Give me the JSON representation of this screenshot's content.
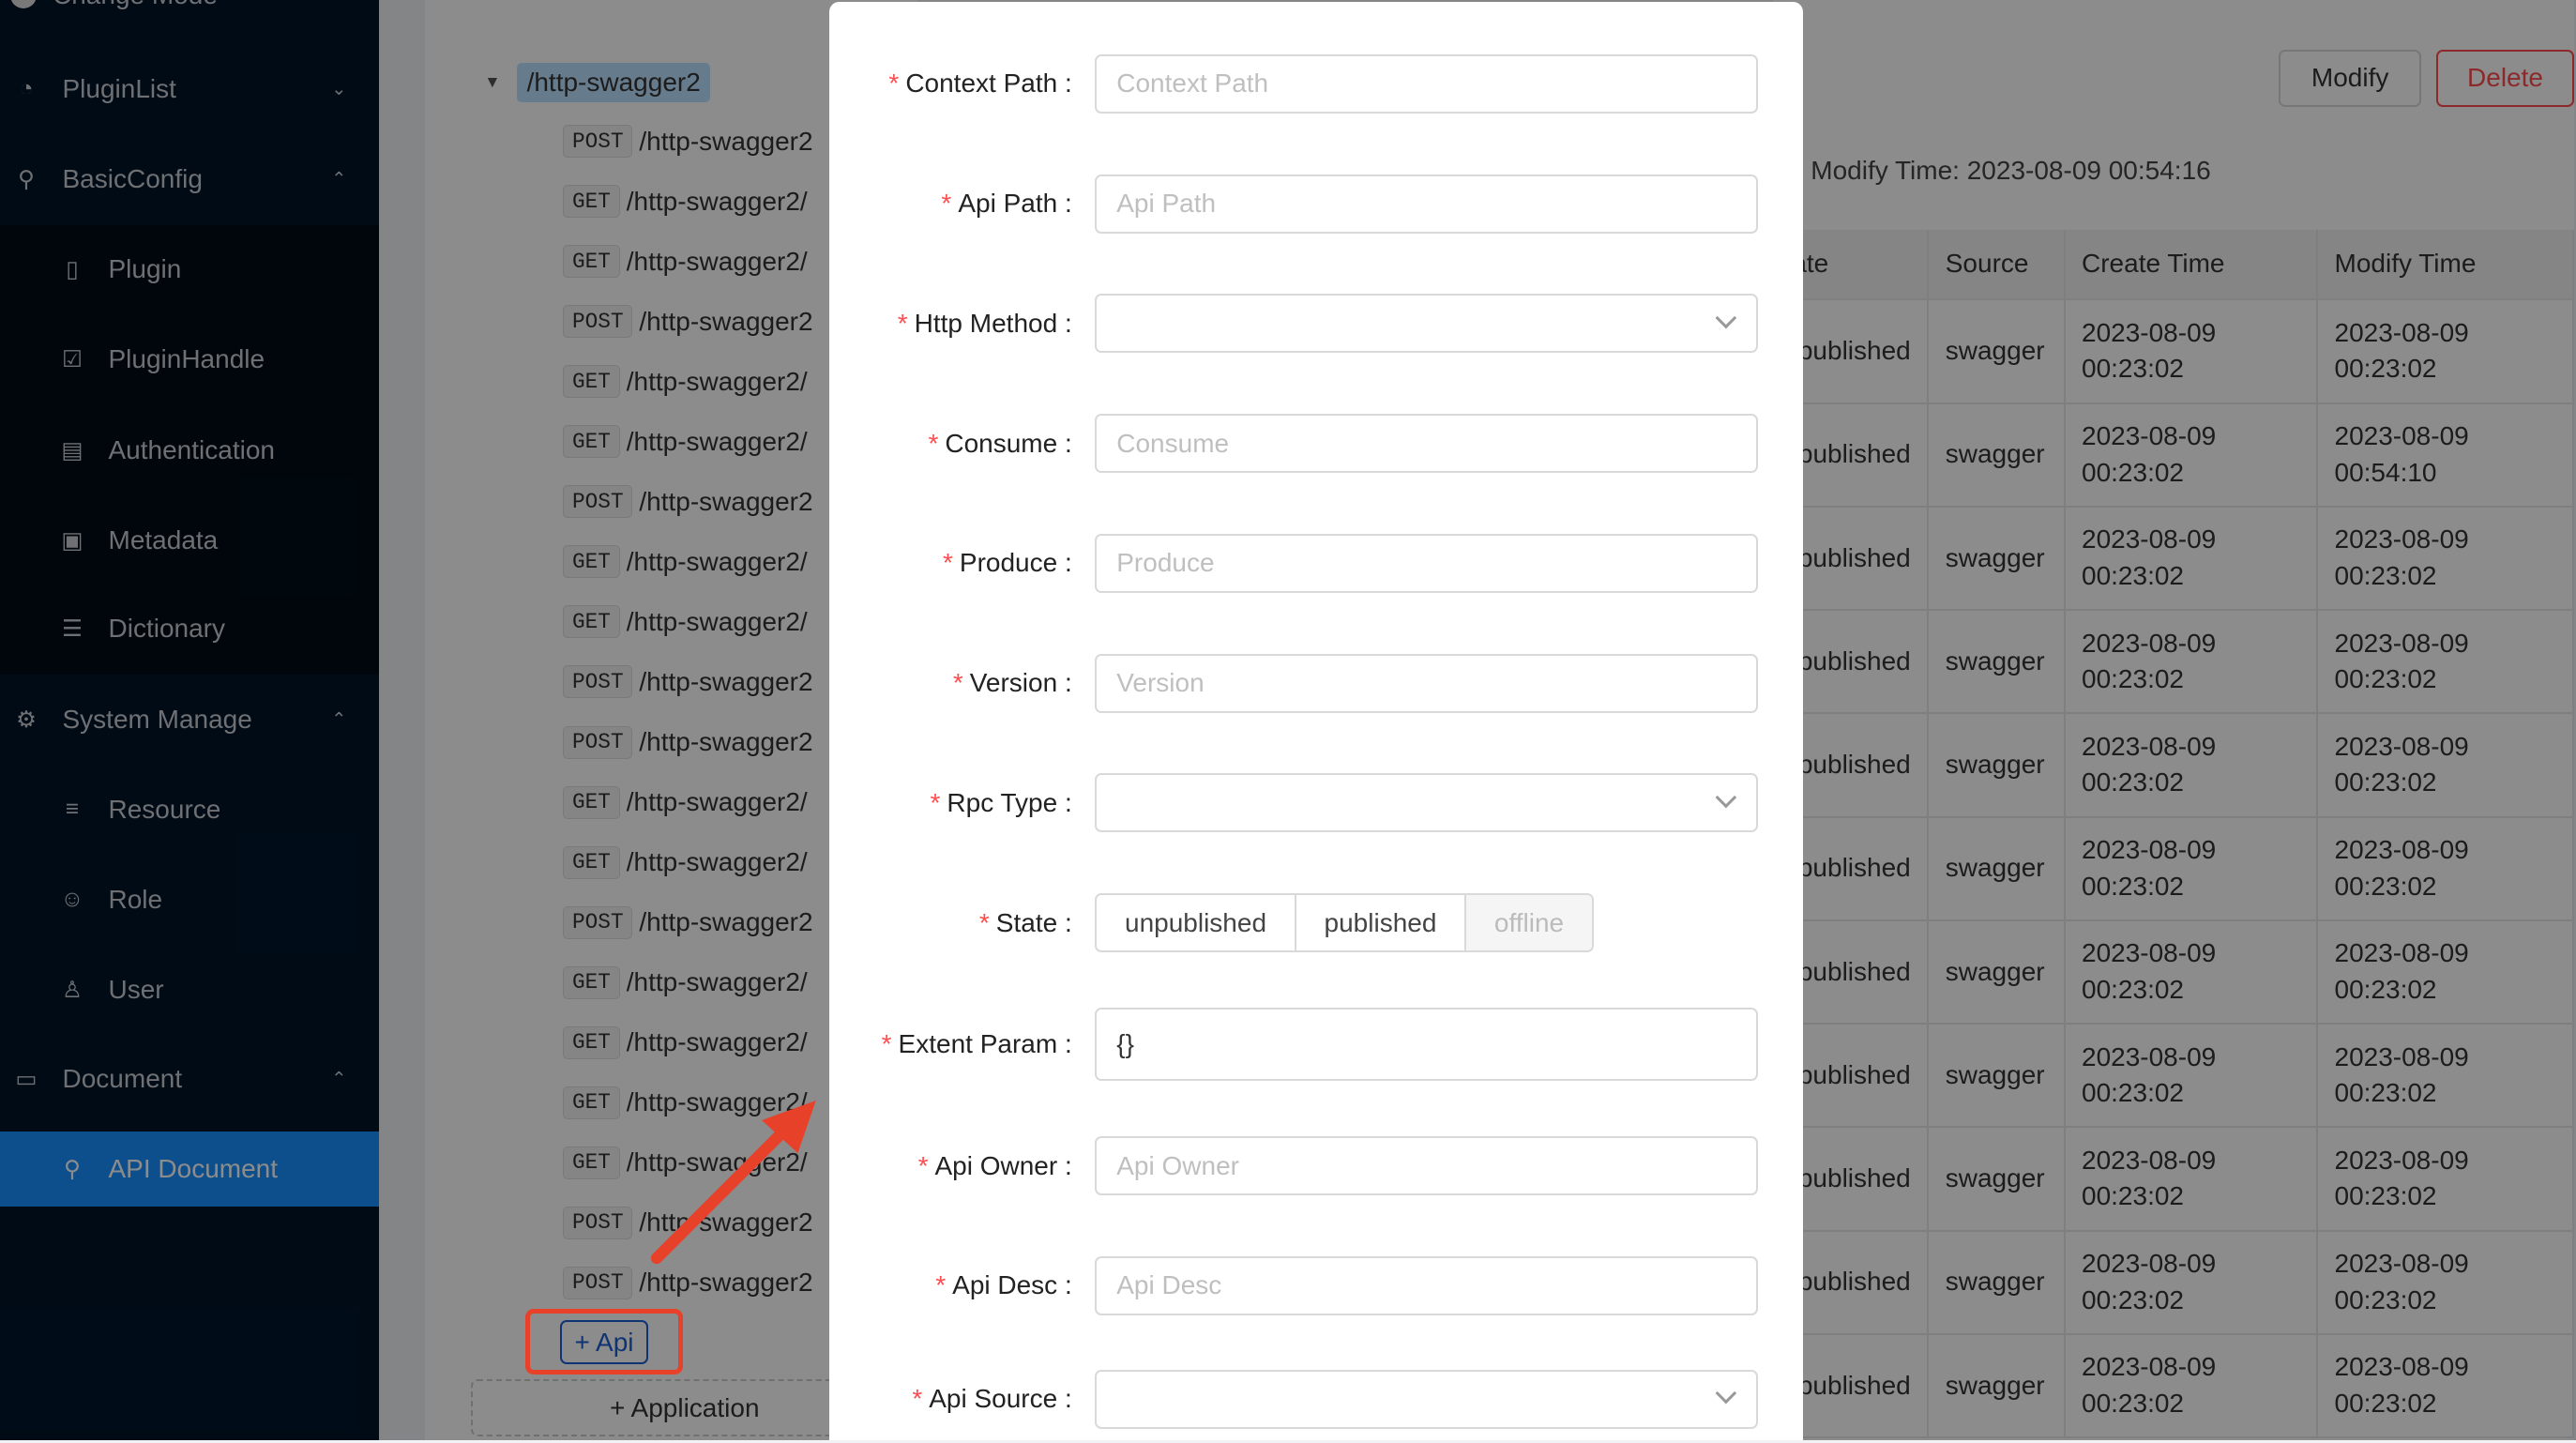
{
  "sidebar": {
    "change_mode": "Change Mode",
    "items": [
      {
        "label": "PluginList",
        "icon": "dashboard-icon",
        "arrow": "v"
      },
      {
        "label": "BasicConfig",
        "icon": "link-icon",
        "arrow": "^"
      },
      {
        "label": "Plugin",
        "icon": "book-icon"
      },
      {
        "label": "PluginHandle",
        "icon": "checkbox-icon"
      },
      {
        "label": "Authentication",
        "icon": "auth-icon"
      },
      {
        "label": "Metadata",
        "icon": "clipboard-icon"
      },
      {
        "label": "Dictionary",
        "icon": "list-icon"
      },
      {
        "label": "System Manage",
        "icon": "gear-icon",
        "arrow": "^"
      },
      {
        "label": "Resource",
        "icon": "menu-icon"
      },
      {
        "label": "Role",
        "icon": "role-icon"
      },
      {
        "label": "User",
        "icon": "user-icon"
      },
      {
        "label": "Document",
        "icon": "document-icon",
        "arrow": "^"
      },
      {
        "label": "API Document",
        "icon": "api-icon"
      }
    ],
    "selected": "API Document"
  },
  "tree": {
    "root": "/http-swagger2",
    "apis": [
      {
        "method": "POST",
        "path": "/http-swagger2"
      },
      {
        "method": "GET",
        "path": "/http-swagger2/"
      },
      {
        "method": "GET",
        "path": "/http-swagger2/"
      },
      {
        "method": "POST",
        "path": "/http-swagger2"
      },
      {
        "method": "GET",
        "path": "/http-swagger2/"
      },
      {
        "method": "GET",
        "path": "/http-swagger2/"
      },
      {
        "method": "POST",
        "path": "/http-swagger2"
      },
      {
        "method": "GET",
        "path": "/http-swagger2/"
      },
      {
        "method": "GET",
        "path": "/http-swagger2/"
      },
      {
        "method": "POST",
        "path": "/http-swagger2"
      },
      {
        "method": "POST",
        "path": "/http-swagger2"
      },
      {
        "method": "GET",
        "path": "/http-swagger2/"
      },
      {
        "method": "GET",
        "path": "/http-swagger2/"
      },
      {
        "method": "POST",
        "path": "/http-swagger2"
      },
      {
        "method": "GET",
        "path": "/http-swagger2/"
      },
      {
        "method": "GET",
        "path": "/http-swagger2/"
      },
      {
        "method": "GET",
        "path": "/http-swagger2/"
      },
      {
        "method": "GET",
        "path": "/http-swagger2/"
      },
      {
        "method": "POST",
        "path": "/http-swagger2"
      },
      {
        "method": "POST",
        "path": "/http-swagger2"
      }
    ],
    "add_api": "+ Api",
    "add_application": "+ Application"
  },
  "detail": {
    "modify_button": "Modify",
    "delete_button": "Delete",
    "modify_time": "Modify Time: 2023-08-09 00:54:16",
    "columns": [
      "State",
      "Source",
      "Create Time",
      "Modify Time"
    ],
    "rows": [
      {
        "state": "unpublished",
        "source": "swagger",
        "create": [
          "2023-08-09",
          "00:23:02"
        ],
        "modify": [
          "2023-08-09",
          "00:23:02"
        ]
      },
      {
        "state": "published",
        "source": "swagger",
        "create": [
          "2023-08-09",
          "00:23:02"
        ],
        "modify": [
          "2023-08-09",
          "00:54:10"
        ]
      },
      {
        "state": "unpublished",
        "source": "swagger",
        "create": [
          "2023-08-09",
          "00:23:02"
        ],
        "modify": [
          "2023-08-09",
          "00:23:02"
        ]
      },
      {
        "state": "unpublished",
        "source": "swagger",
        "create": [
          "2023-08-09",
          "00:23:02"
        ],
        "modify": [
          "2023-08-09",
          "00:23:02"
        ]
      },
      {
        "state": "unpublished",
        "source": "swagger",
        "create": [
          "2023-08-09",
          "00:23:02"
        ],
        "modify": [
          "2023-08-09",
          "00:23:02"
        ]
      },
      {
        "state": "unpublished",
        "source": "swagger",
        "create": [
          "2023-08-09",
          "00:23:02"
        ],
        "modify": [
          "2023-08-09",
          "00:23:02"
        ]
      },
      {
        "state": "unpublished",
        "source": "swagger",
        "create": [
          "2023-08-09",
          "00:23:02"
        ],
        "modify": [
          "2023-08-09",
          "00:23:02"
        ]
      },
      {
        "state": "unpublished",
        "source": "swagger",
        "create": [
          "2023-08-09",
          "00:23:02"
        ],
        "modify": [
          "2023-08-09",
          "00:23:02"
        ]
      },
      {
        "state": "unpublished",
        "source": "swagger",
        "create": [
          "2023-08-09",
          "00:23:02"
        ],
        "modify": [
          "2023-08-09",
          "00:23:02"
        ]
      },
      {
        "state": "unpublished",
        "source": "swagger",
        "create": [
          "2023-08-09",
          "00:23:02"
        ],
        "modify": [
          "2023-08-09",
          "00:23:02"
        ]
      },
      {
        "state": "unpublished",
        "source": "swagger",
        "create": [
          "2023-08-09",
          "00:23:02"
        ],
        "modify": [
          "2023-08-09",
          "00:23:02"
        ]
      }
    ]
  },
  "form": {
    "fields": [
      {
        "label": "Context Path",
        "type": "input",
        "placeholder": "Context Path"
      },
      {
        "label": "Api Path",
        "type": "input",
        "placeholder": "Api Path"
      },
      {
        "label": "Http Method",
        "type": "select",
        "placeholder": ""
      },
      {
        "label": "Consume",
        "type": "input",
        "placeholder": "Consume"
      },
      {
        "label": "Produce",
        "type": "input",
        "placeholder": "Produce"
      },
      {
        "label": "Version",
        "type": "input",
        "placeholder": "Version"
      },
      {
        "label": "Rpc Type",
        "type": "select",
        "placeholder": ""
      },
      {
        "label": "State",
        "type": "segmented",
        "options": [
          "unpublished",
          "published",
          "offline"
        ],
        "disabled": "offline"
      },
      {
        "label": "Extent Param",
        "type": "textarea",
        "value": "{}"
      },
      {
        "label": "Api Owner",
        "type": "input",
        "placeholder": "Api Owner"
      },
      {
        "label": "Api Desc",
        "type": "input",
        "placeholder": "Api Desc"
      },
      {
        "label": "Api Source",
        "type": "select",
        "placeholder": ""
      }
    ]
  },
  "colors": {
    "sidebar": "#001529",
    "selected": "#1890ff",
    "danger": "#ff4d4f",
    "annotation": "#e8412a",
    "api_button": "#1d5fd1"
  }
}
